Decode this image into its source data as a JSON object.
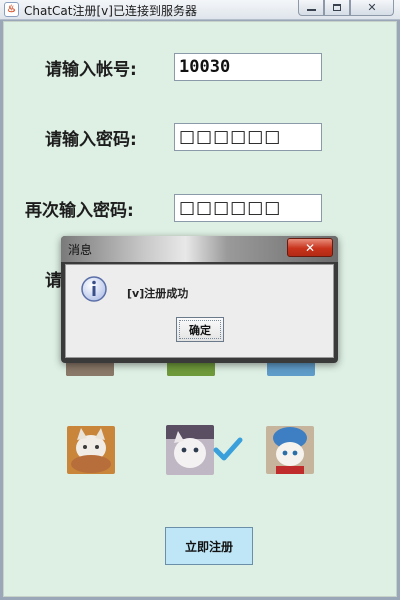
{
  "window": {
    "title": "ChatCat注册[v]已连接到服务器",
    "app_icon": "java-cup-icon",
    "client_bg": "#def0e4"
  },
  "form": {
    "account_label": "请输入帐号:",
    "account_value": "10030",
    "password_label": "请输入密码:",
    "password_value": "□□□□□□",
    "confirm_label": "再次输入密码:",
    "confirm_value": "□□□□□□",
    "avatar_label": "请"
  },
  "avatars": {
    "count_visible": 6,
    "selected_index": 4,
    "check_icon": "checkmark-icon"
  },
  "submit": {
    "label": "立即注册"
  },
  "dialog": {
    "title": "消息",
    "close_glyph": "✕",
    "icon": "info-icon",
    "message": "[v]注册成功",
    "ok_label": "确定"
  }
}
